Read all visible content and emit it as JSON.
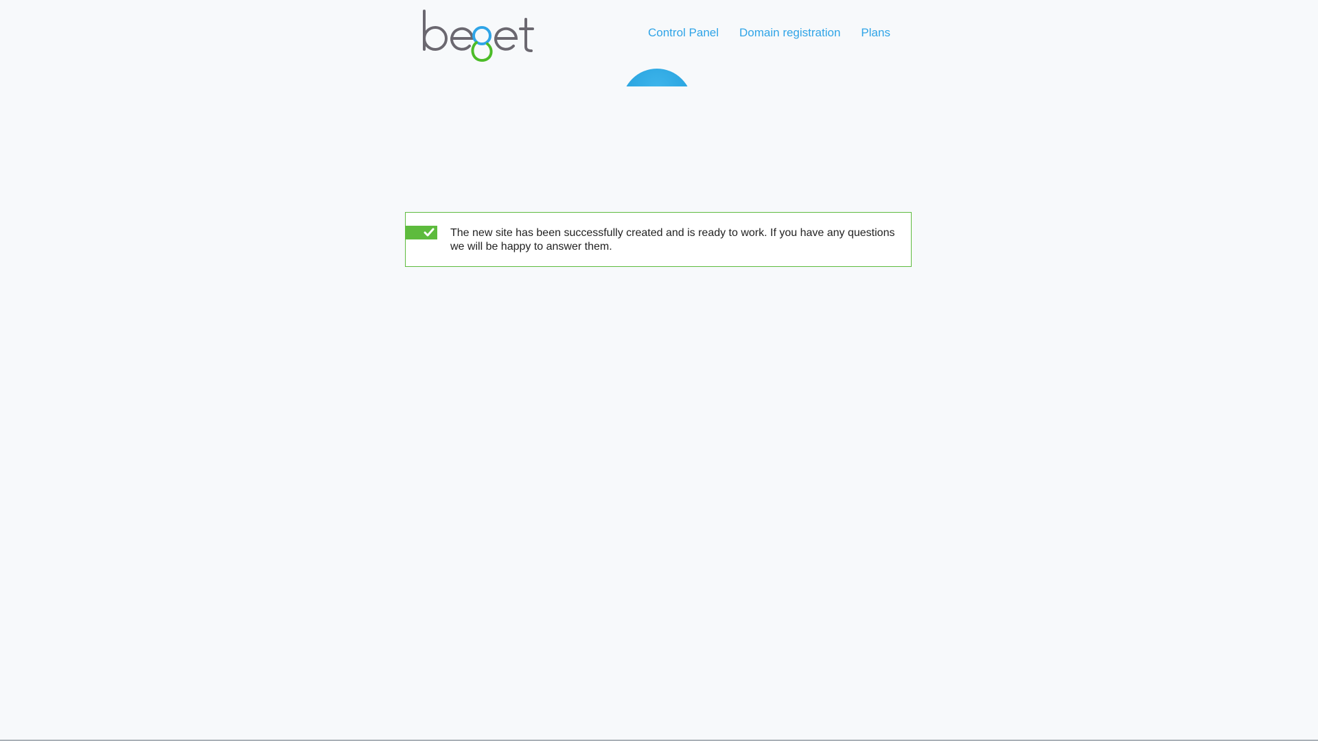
{
  "brand": {
    "logo_text": "beget",
    "colors": {
      "logo_gray": "#6b6870",
      "logo_blue": "#2fa4e7",
      "logo_green": "#4cbc28"
    }
  },
  "nav": {
    "items": [
      {
        "label": "Control Panel",
        "icon": ""
      },
      {
        "label": "Domain registration",
        "icon": ""
      },
      {
        "label": "Plans",
        "icon": ""
      }
    ],
    "link_color": "#2fa4e7"
  },
  "hero": {
    "icon": "partial-blue-circle",
    "color": "#2fa4e7"
  },
  "alert": {
    "type": "success",
    "icon": "checkmark-icon",
    "accent_color": "#5dbb3d",
    "message": "The new site has been successfully created and is ready to work. If you have any questions we will be happy to answer them."
  }
}
